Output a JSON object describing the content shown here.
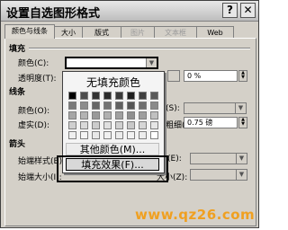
{
  "window": {
    "title": "设置自选图形格式",
    "help_glyph": "?",
    "close_glyph": "✕"
  },
  "tabs": [
    {
      "label": "颜色与线条",
      "state": "active"
    },
    {
      "label": "大小",
      "state": "normal"
    },
    {
      "label": "版式",
      "state": "normal"
    },
    {
      "label": "图片",
      "state": "disabled"
    },
    {
      "label": "文本框",
      "state": "disabled"
    },
    {
      "label": "Web",
      "state": "normal"
    }
  ],
  "fill": {
    "section": "填充",
    "color_label": "颜色(C):",
    "transparency_label": "透明度(T):",
    "transparency_value": "0 %"
  },
  "line": {
    "section": "线条",
    "color_label": "颜色(O):",
    "dash_label": "虚实(D):",
    "weight_label": "粗细(W):",
    "weight_value": "0.75 磅",
    "style_label_tail": "(S):"
  },
  "arrows": {
    "section": "箭头",
    "begin_style_label": "始端样式(B):",
    "begin_size_label": "始端大小(I):",
    "end_style_label_tail": "(E):",
    "end_size_label_tail": "大小(Z):"
  },
  "color_popup": {
    "no_fill": "无填充颜色",
    "more_colors": "其他颜色(M)...",
    "fill_effects": "填充效果(F)..."
  },
  "swatch_rows": [
    [
      "#000000",
      "#4d4d4d",
      "#333333",
      "#2b2b2b",
      "#3a3a3a",
      "#1f1f1f",
      "#404040",
      "#5a5a5a"
    ],
    [
      "#7a7a7a",
      "#8c8c8c",
      "#666666",
      "#737373",
      "#606060",
      "#555555",
      "#6f6f6f",
      "#8a8a8a"
    ],
    [
      "#a6a6a6",
      "#b3b3b3",
      "#999999",
      "#b0b0b0",
      "#a0a0a0",
      "#8f8f8f",
      "#9e9e9e",
      "#c0c0c0"
    ],
    [
      "#cfcfcf",
      "#d9d9d9",
      "#cccccc",
      "#e0e0e0",
      "#d0d0d0",
      "#c8c8c8",
      "#d6d6d6",
      "#e6e6e6"
    ],
    [
      "#efefef",
      "#f5f5f5",
      "#e8e8e8",
      "#f0f0f0",
      "#ebebeb",
      "#f2f2f2",
      "#ececec",
      "#ffffff"
    ]
  ],
  "watermark": "www.qz26.com"
}
